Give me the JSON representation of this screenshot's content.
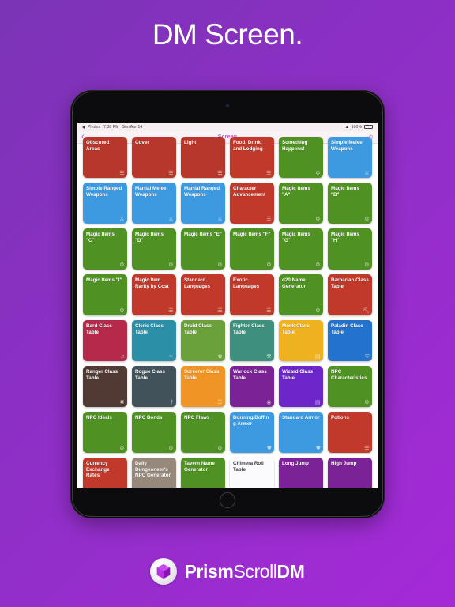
{
  "headline": "DM Screen.",
  "brand": {
    "logo_icon": "prism-hexagon-icon",
    "part1": "Prism",
    "part2": "Scroll",
    "part3": "DM"
  },
  "device": {
    "type": "ipad",
    "camera_icon": "front-camera-icon",
    "home_button_label": "Home"
  },
  "status_bar": {
    "back_app_icon": "back-arrow-icon",
    "back_app": "Photos",
    "time": "7:38 PM",
    "date": "Sun Apr 14",
    "wifi_icon": "wifi-icon",
    "battery_percent": "100%",
    "battery_icon": "battery-full-icon"
  },
  "nav_bar": {
    "back_icon": "chevron-left-icon",
    "title": "Screen",
    "settings_icon": "gear-icon"
  },
  "colors": {
    "accent_purple": "#b75ad2",
    "red": "#c0392b",
    "green": "#4f9122",
    "blue": "#3498db",
    "purple": "#8e24aa",
    "background_top": "#7b34b6",
    "background_bottom": "#a52ad8"
  },
  "tiles": [
    {
      "label": "Obscured Areas",
      "color": "#b7372c",
      "icon": "table-icon",
      "icon_glyph": "☰",
      "clipped": true
    },
    {
      "label": "Cover",
      "color": "#b7372c",
      "icon": "table-icon",
      "icon_glyph": "☰",
      "clipped": true
    },
    {
      "label": "Light",
      "color": "#b7372c",
      "icon": "table-icon",
      "icon_glyph": "☰",
      "clipped": true
    },
    {
      "label": "Food, Drink, and Lodging",
      "color": "#c0392b",
      "icon": "table-icon",
      "icon_glyph": "☰",
      "clipped": true
    },
    {
      "label": "Something Happens!",
      "color": "#4f9122",
      "icon": "gear-icon",
      "icon_glyph": "⚙",
      "clipped": true
    },
    {
      "label": "Simple Melee Weapons",
      "color": "#3d9ae0",
      "icon": "sword-icon",
      "icon_glyph": "⚔",
      "clipped": true
    },
    {
      "label": "Simple Ranged Weapons",
      "color": "#3d9ae0",
      "icon": "sword-icon",
      "icon_glyph": "⚔"
    },
    {
      "label": "Martial Melee Weapons",
      "color": "#3d9ae0",
      "icon": "sword-icon",
      "icon_glyph": "⚔"
    },
    {
      "label": "Martial Ranged Weapons",
      "color": "#3d9ae0",
      "icon": "sword-icon",
      "icon_glyph": "⚔"
    },
    {
      "label": "Character Advancement",
      "color": "#c0392b",
      "icon": "table-icon",
      "icon_glyph": "☰"
    },
    {
      "label": "Magic Items \"A\"",
      "color": "#4f9122",
      "icon": "gear-icon",
      "icon_glyph": "⚙"
    },
    {
      "label": "Magic Items \"B\"",
      "color": "#4f9122",
      "icon": "gear-icon",
      "icon_glyph": "⚙"
    },
    {
      "label": "Magic Items \"C\"",
      "color": "#4f9122",
      "icon": "gear-icon",
      "icon_glyph": "⚙"
    },
    {
      "label": "Magic Items \"D\"",
      "color": "#4f9122",
      "icon": "gear-icon",
      "icon_glyph": "⚙"
    },
    {
      "label": "Magic Items \"E\"",
      "color": "#4f9122",
      "icon": "gear-icon",
      "icon_glyph": "⚙"
    },
    {
      "label": "Magic Items \"F\"",
      "color": "#4f9122",
      "icon": "gear-icon",
      "icon_glyph": "⚙"
    },
    {
      "label": "Magic Items \"G\"",
      "color": "#4f9122",
      "icon": "gear-icon",
      "icon_glyph": "⚙"
    },
    {
      "label": "Magic Items \"H\"",
      "color": "#4f9122",
      "icon": "gear-icon",
      "icon_glyph": "⚙"
    },
    {
      "label": "Magic Items \"I\"",
      "color": "#4f9122",
      "icon": "gear-icon",
      "icon_glyph": "⚙"
    },
    {
      "label": "Magic Item Rarity by Cost",
      "color": "#c0392b",
      "icon": "table-icon",
      "icon_glyph": "☰"
    },
    {
      "label": "Standard Languages",
      "color": "#c0392b",
      "icon": "table-icon",
      "icon_glyph": "☰"
    },
    {
      "label": "Exotic Languages",
      "color": "#c0392b",
      "icon": "table-icon",
      "icon_glyph": "☰"
    },
    {
      "label": "d20 Name Generator",
      "color": "#4f9122",
      "icon": "gear-icon",
      "icon_glyph": "⚙"
    },
    {
      "label": "Barbarian Class Table",
      "color": "#c0392b",
      "icon": "axe-icon",
      "icon_glyph": "⛏"
    },
    {
      "label": "Bard Class Table",
      "color": "#b5294b",
      "icon": "lute-icon",
      "icon_glyph": "♫"
    },
    {
      "label": "Cleric Class Table",
      "color": "#2b8fa8",
      "icon": "sun-icon",
      "icon_glyph": "☀"
    },
    {
      "label": "Druid Class Table",
      "color": "#6aa13a",
      "icon": "leaf-icon",
      "icon_glyph": "✿"
    },
    {
      "label": "Fighter Class Table",
      "color": "#3e8f7c",
      "icon": "helmet-icon",
      "icon_glyph": "⚒"
    },
    {
      "label": "Monk Class Table",
      "color": "#eeb11f",
      "icon": "scroll-icon",
      "icon_glyph": "▤"
    },
    {
      "label": "Paladin Class Table",
      "color": "#2372cd",
      "icon": "shield-icon",
      "icon_glyph": "⛨"
    },
    {
      "label": "Ranger Class Table",
      "color": "#503a33",
      "icon": "bow-icon",
      "icon_glyph": "✖"
    },
    {
      "label": "Rogue Class Table",
      "color": "#41525b",
      "icon": "dagger-icon",
      "icon_glyph": "†"
    },
    {
      "label": "Sorcerer Class Table",
      "color": "#ef9425",
      "icon": "flame-icon",
      "icon_glyph": "☲"
    },
    {
      "label": "Warlock Class Table",
      "color": "#7b2396",
      "icon": "eye-icon",
      "icon_glyph": "◉"
    },
    {
      "label": "Wizard Class Table",
      "color": "#6c26c9",
      "icon": "book-icon",
      "icon_glyph": "▤"
    },
    {
      "label": "NPC Characteristics",
      "color": "#4f9122",
      "icon": "gear-icon",
      "icon_glyph": "⚙"
    },
    {
      "label": "NPC Ideals",
      "color": "#4f9122",
      "icon": "gear-icon",
      "icon_glyph": "⚙"
    },
    {
      "label": "NPC Bonds",
      "color": "#4f9122",
      "icon": "gear-icon",
      "icon_glyph": "⚙"
    },
    {
      "label": "NPC Flaws",
      "color": "#4f9122",
      "icon": "gear-icon",
      "icon_glyph": "⚙"
    },
    {
      "label": "Donning/Doffing Armor",
      "color": "#3d9ae0",
      "icon": "armor-icon",
      "icon_glyph": "⛊"
    },
    {
      "label": "Standard Armor",
      "color": "#3d9ae0",
      "icon": "armor-icon",
      "icon_glyph": "⛊"
    },
    {
      "label": "Potions",
      "color": "#c0392b",
      "icon": "table-icon",
      "icon_glyph": "☰"
    },
    {
      "label": "Currency Exchange Rates",
      "color": "#c0392b",
      "icon": "table-icon",
      "icon_glyph": "☰"
    },
    {
      "label": "Daily Dungeoneer's NPC Generator",
      "color": "#96887b",
      "icon": "gear-icon",
      "icon_glyph": "⚙",
      "photo": true
    },
    {
      "label": "Tavern Name Generator",
      "color": "#4f9122",
      "icon": "gear-icon",
      "icon_glyph": "⚙"
    },
    {
      "label": "Chimera Roll Table",
      "color": "#fbfbfd",
      "icon": "die-icon",
      "icon_glyph": "◆",
      "light": true
    },
    {
      "label": "Long Jump",
      "color": "#7b2396",
      "icon": "ruler-icon",
      "icon_glyph": "▯"
    },
    {
      "label": "High Jump",
      "color": "#7b2396",
      "icon": "ruler-icon",
      "icon_glyph": "▯"
    }
  ]
}
